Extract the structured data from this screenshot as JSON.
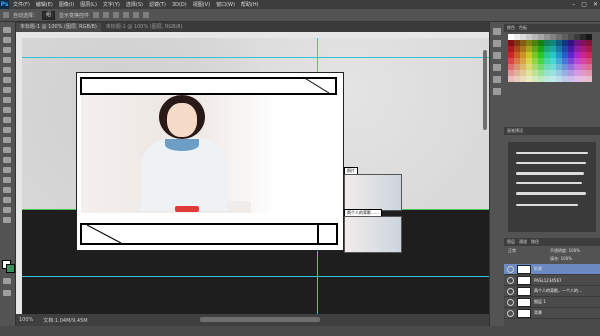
{
  "app": {
    "logo": "Ps"
  },
  "menu": [
    "文件(F)",
    "编辑(E)",
    "图像(I)",
    "图层(L)",
    "文字(Y)",
    "选择(S)",
    "滤镜(T)",
    "3D(D)",
    "视图(V)",
    "窗口(W)",
    "帮助(H)"
  ],
  "window_buttons": [
    "–",
    "▢",
    "✕"
  ],
  "options": {
    "auto_select": "自动选择：",
    "group": "组",
    "transform": "显示变换控件"
  },
  "tabs": {
    "active": "未标题-1 @ 100% (图层, RGB/8)",
    "inactive": "未标题-1 @ 100% (图层, RGB/8)"
  },
  "thumbnails": {
    "label1": "照片",
    "label2": "两个人的背影……"
  },
  "status": {
    "zoom": "100%",
    "doc": "文档:1.04M/9.45M"
  },
  "panels": {
    "color_tabs": [
      "颜色",
      "色板"
    ],
    "brush_tabs": [
      "画笔预设"
    ],
    "layer_tabs": [
      "图层",
      "通道",
      "路径"
    ],
    "layer_mode": "正常",
    "opacity": "不透明度: 100%",
    "fill": "填充: 100%"
  },
  "layers": [
    {
      "name": "形状",
      "selected": true
    },
    {
      "name": "P6SL1234567",
      "selected": false
    },
    {
      "name": "两个人的背影，一个人的…",
      "selected": false
    },
    {
      "name": "图层 1",
      "selected": false
    },
    {
      "name": "背景",
      "selected": false
    }
  ],
  "colors": {
    "accent": "#31a8ff",
    "guide": "#2ec6d6",
    "selection": "#6b8ac2"
  }
}
